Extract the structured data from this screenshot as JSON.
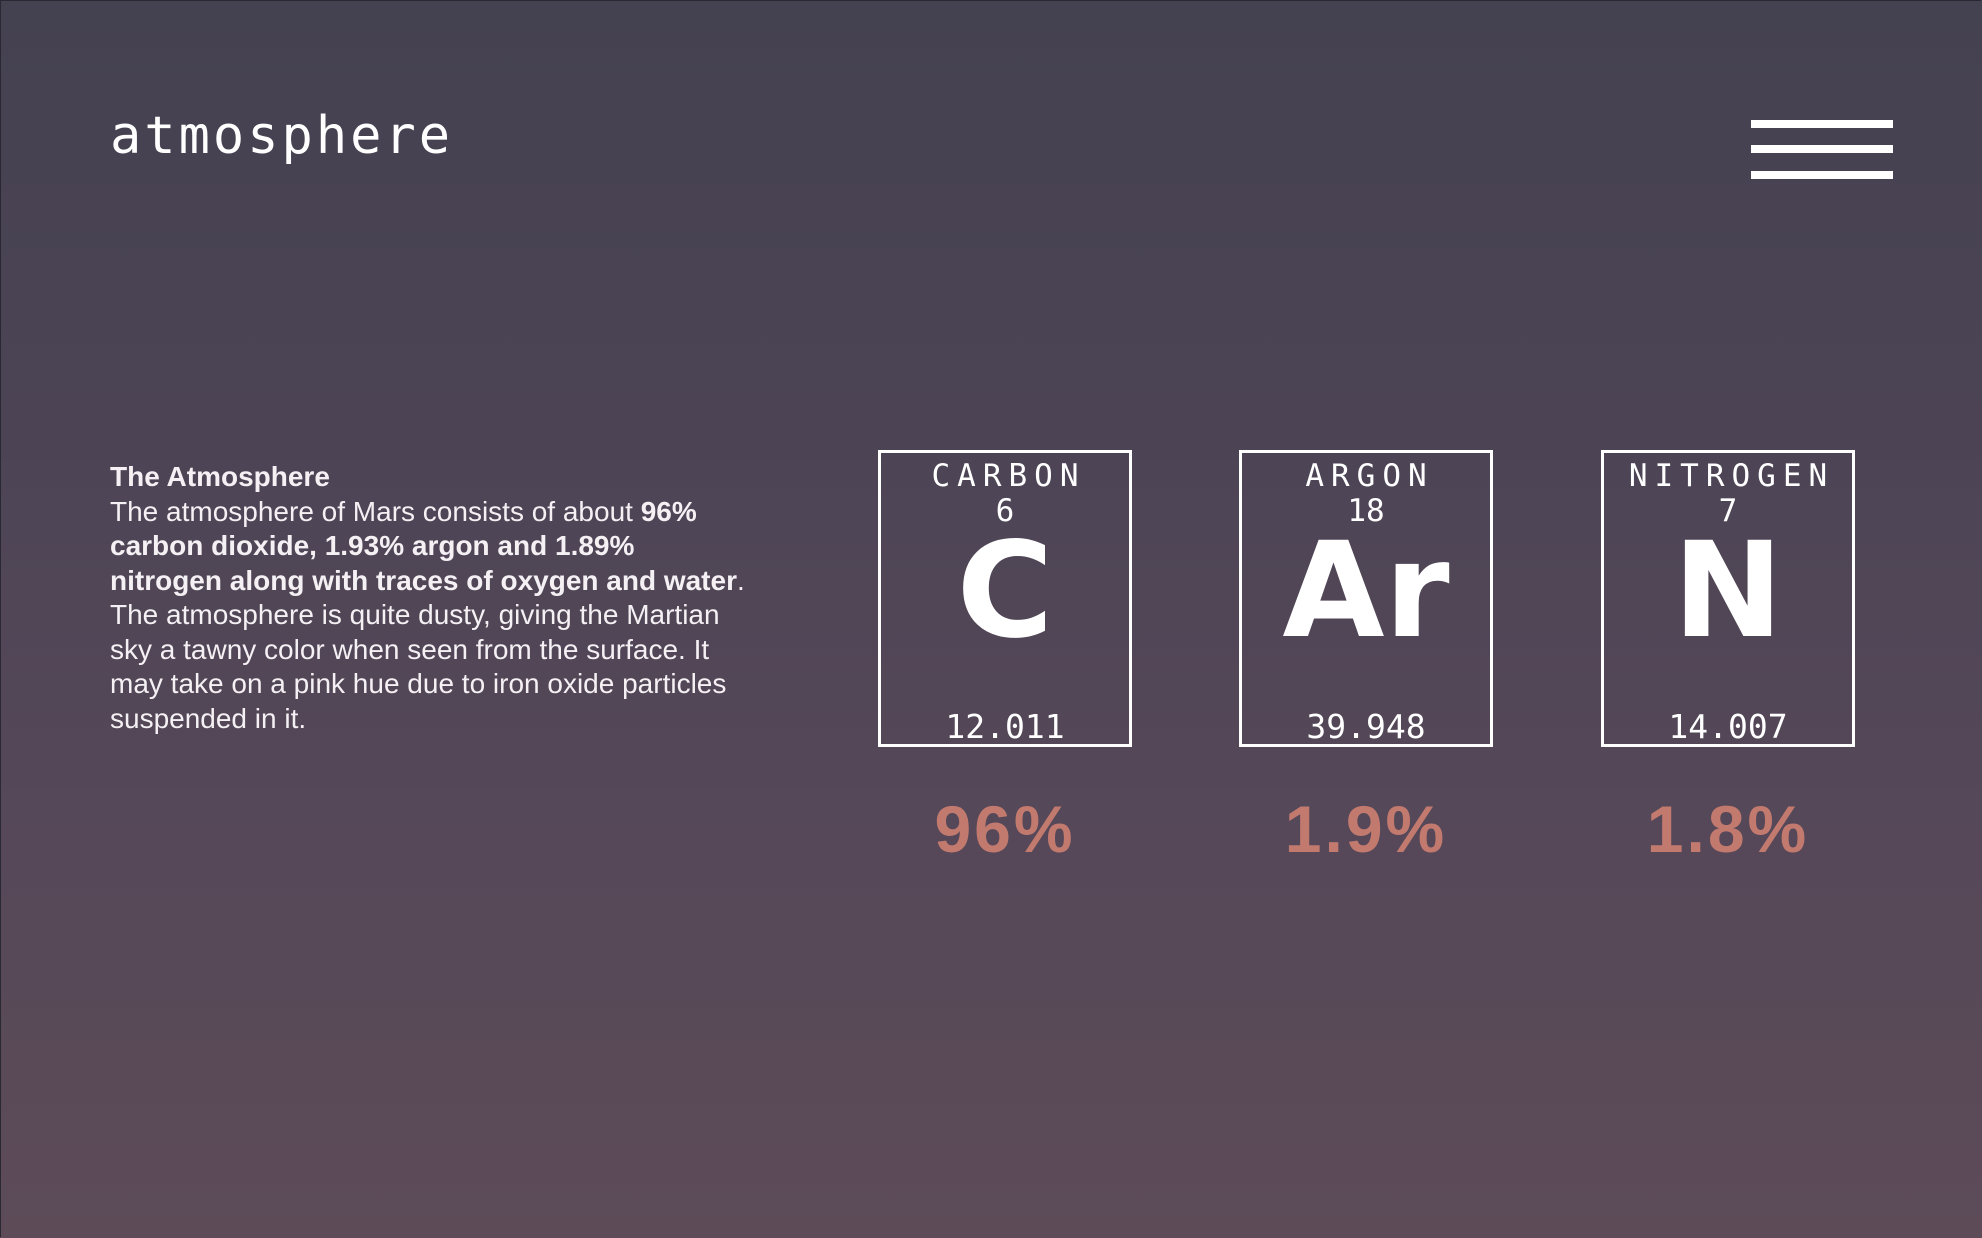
{
  "header": {
    "title": "atmosphere",
    "menu_icon": "hamburger-menu-icon"
  },
  "description": {
    "heading": "The Atmosphere",
    "text_intro": "The atmosphere of Mars consists of about ",
    "text_bold": "96% carbon dioxide, 1.93% argon and 1.89% nitrogen along with traces of oxygen and water",
    "text_rest": ". The atmosphere is quite dusty, giving the Martian sky a tawny color when seen from the surface. It may take on a pink hue due to iron oxide particles suspended in it."
  },
  "elements": [
    {
      "name": "CARBON",
      "number": "6",
      "symbol": "C",
      "mass": "12.011",
      "percent": "96%"
    },
    {
      "name": "ARGON",
      "number": "18",
      "symbol": "Ar",
      "mass": "39.948",
      "percent": "1.9%"
    },
    {
      "name": "NITROGEN",
      "number": "7",
      "symbol": "N",
      "mass": "14.007",
      "percent": "1.8%"
    }
  ],
  "colors": {
    "percent": "#c27a6f",
    "text": "#ffffff",
    "background_top": "#444150",
    "background_bottom": "#5d4b58"
  }
}
